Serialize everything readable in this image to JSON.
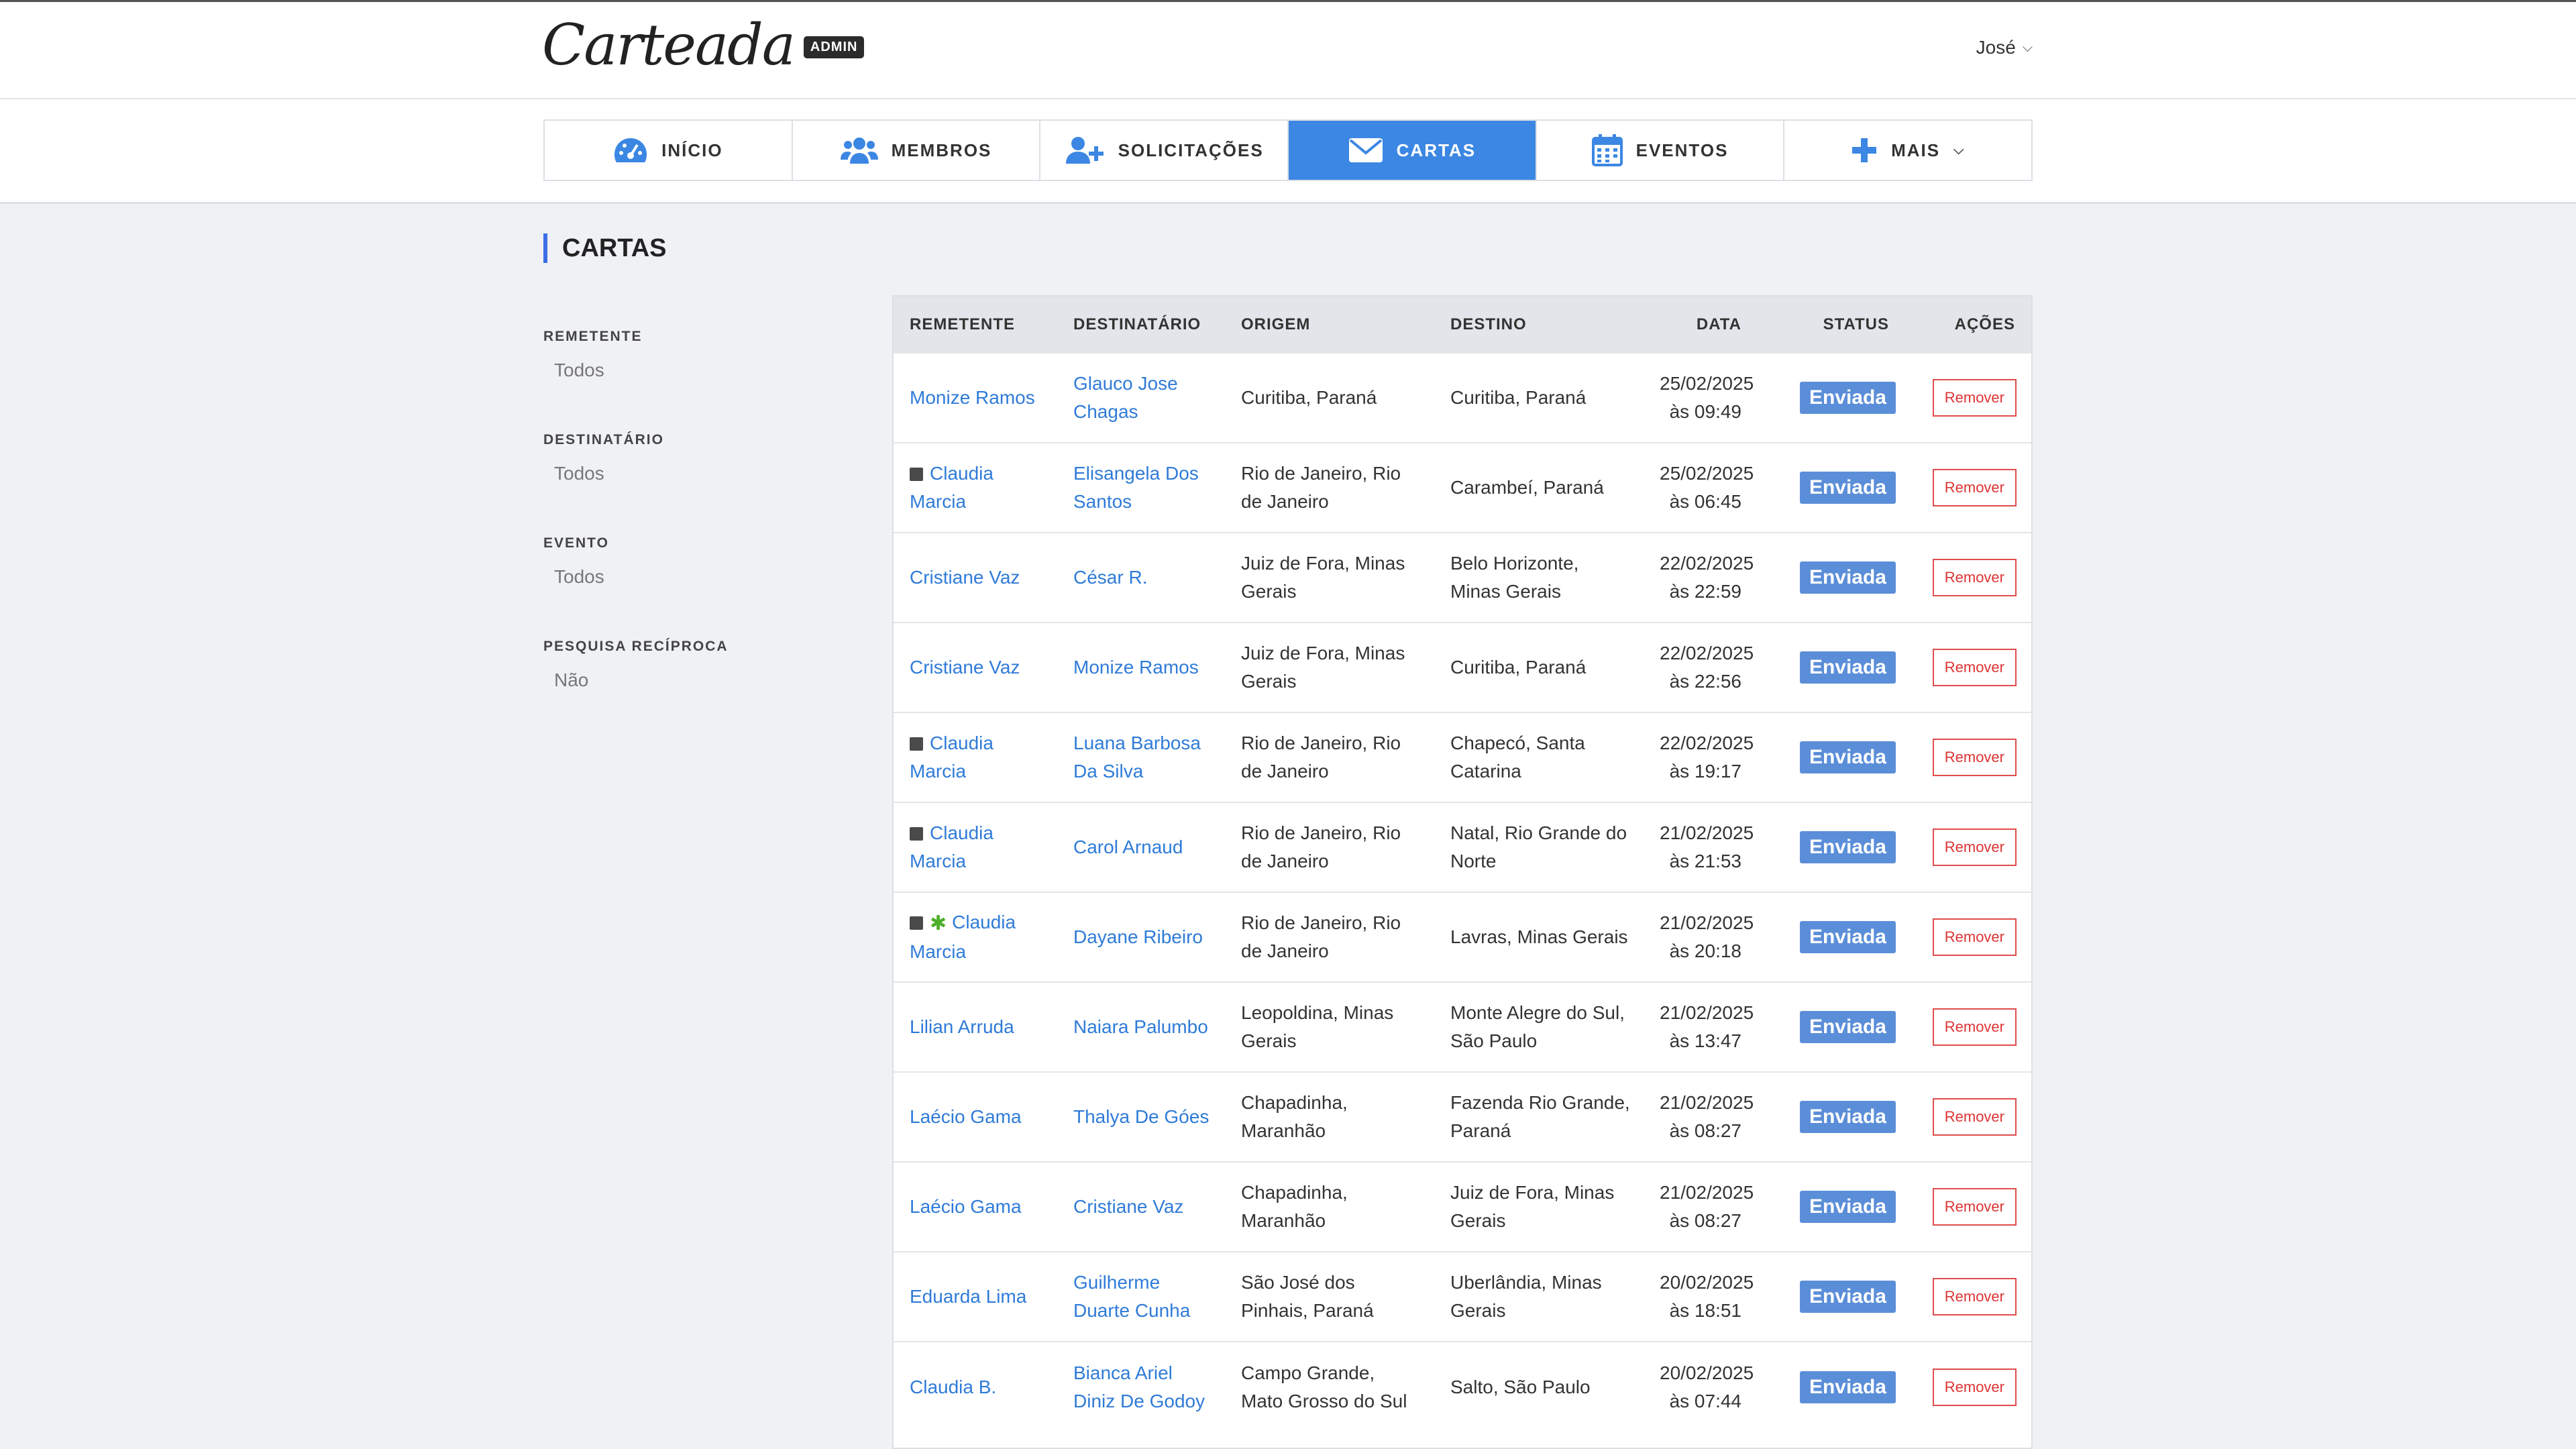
{
  "header": {
    "logo_text": "Carteada",
    "admin_badge": "ADMIN",
    "user_name": "José"
  },
  "nav": [
    {
      "label": "INÍCIO",
      "icon": "dashboard-icon",
      "active": false
    },
    {
      "label": "MEMBROS",
      "icon": "users-icon",
      "active": false
    },
    {
      "label": "SOLICITAÇÕES",
      "icon": "user-plus-icon",
      "active": false
    },
    {
      "label": "CARTAS",
      "icon": "envelope-icon",
      "active": true
    },
    {
      "label": "EVENTOS",
      "icon": "calendar-icon",
      "active": false
    },
    {
      "label": "MAIS",
      "icon": "plus-icon",
      "active": false
    }
  ],
  "page": {
    "title": "CARTAS"
  },
  "filters": [
    {
      "label": "REMETENTE",
      "value": "Todos"
    },
    {
      "label": "DESTINATÁRIO",
      "value": "Todos"
    },
    {
      "label": "EVENTO",
      "value": "Todos"
    },
    {
      "label": "PESQUISA RECÍPROCA",
      "value": "Não"
    }
  ],
  "table": {
    "columns": [
      "REMETENTE",
      "DESTINATÁRIO",
      "ORIGEM",
      "DESTINO",
      "DATA",
      "STATUS",
      "AÇÕES"
    ],
    "rows": [
      {
        "sender": "Monize Ramos",
        "recipient": "Glauco Jose Chagas",
        "origin": "Curitiba, Paraná",
        "destination": "Curitiba, Paraná",
        "date": "25/02/2025",
        "time": "às 09:49",
        "status": "Enviada",
        "action": "Remover",
        "note": false,
        "star": false
      },
      {
        "sender": "Claudia Marcia",
        "recipient": "Elisangela Dos Santos",
        "origin": "Rio de Janeiro, Rio de Janeiro",
        "destination": "Carambeí, Paraná",
        "date": "25/02/2025",
        "time": "às 06:45",
        "status": "Enviada",
        "action": "Remover",
        "note": true,
        "star": false
      },
      {
        "sender": "Cristiane Vaz",
        "recipient": "César R.",
        "origin": "Juiz de Fora, Minas Gerais",
        "destination": "Belo Horizonte, Minas Gerais",
        "date": "22/02/2025",
        "time": "às 22:59",
        "status": "Enviada",
        "action": "Remover",
        "note": false,
        "star": false
      },
      {
        "sender": "Cristiane Vaz",
        "recipient": "Monize Ramos",
        "origin": "Juiz de Fora, Minas Gerais",
        "destination": "Curitiba, Paraná",
        "date": "22/02/2025",
        "time": "às 22:56",
        "status": "Enviada",
        "action": "Remover",
        "note": false,
        "star": false
      },
      {
        "sender": "Claudia Marcia",
        "recipient": "Luana Barbosa Da Silva",
        "origin": "Rio de Janeiro, Rio de Janeiro",
        "destination": "Chapecó, Santa Catarina",
        "date": "22/02/2025",
        "time": "às 19:17",
        "status": "Enviada",
        "action": "Remover",
        "note": true,
        "star": false
      },
      {
        "sender": "Claudia Marcia",
        "recipient": "Carol Arnaud",
        "origin": "Rio de Janeiro, Rio de Janeiro",
        "destination": "Natal, Rio Grande do Norte",
        "date": "21/02/2025",
        "time": "às 21:53",
        "status": "Enviada",
        "action": "Remover",
        "note": true,
        "star": false
      },
      {
        "sender": "Claudia Marcia",
        "recipient": "Dayane Ribeiro",
        "origin": "Rio de Janeiro, Rio de Janeiro",
        "destination": "Lavras, Minas Gerais",
        "date": "21/02/2025",
        "time": "às 20:18",
        "status": "Enviada",
        "action": "Remover",
        "note": true,
        "star": true
      },
      {
        "sender": "Lilian Arruda",
        "recipient": "Naiara Palumbo",
        "origin": "Leopoldina, Minas Gerais",
        "destination": "Monte Alegre do Sul, São Paulo",
        "date": "21/02/2025",
        "time": "às 13:47",
        "status": "Enviada",
        "action": "Remover",
        "note": false,
        "star": false
      },
      {
        "sender": "Laécio Gama",
        "recipient": "Thalya De Góes",
        "origin": "Chapadinha, Maranhão",
        "destination": "Fazenda Rio Grande, Paraná",
        "date": "21/02/2025",
        "time": "às 08:27",
        "status": "Enviada",
        "action": "Remover",
        "note": false,
        "star": false
      },
      {
        "sender": "Laécio Gama",
        "recipient": "Cristiane Vaz",
        "origin": "Chapadinha, Maranhão",
        "destination": "Juiz de Fora, Minas Gerais",
        "date": "21/02/2025",
        "time": "às 08:27",
        "status": "Enviada",
        "action": "Remover",
        "note": false,
        "star": false
      },
      {
        "sender": "Eduarda Lima",
        "recipient": "Guilherme Duarte Cunha",
        "origin": "São José dos Pinhais, Paraná",
        "destination": "Uberlândia, Minas Gerais",
        "date": "20/02/2025",
        "time": "às 18:51",
        "status": "Enviada",
        "action": "Remover",
        "note": false,
        "star": false
      },
      {
        "sender": "Claudia B.",
        "recipient": "Bianca Ariel Diniz De Godoy",
        "origin": "Campo Grande, Mato Grosso do Sul",
        "destination": "Salto, São Paulo",
        "date": "20/02/2025",
        "time": "às 07:44",
        "status": "Enviada",
        "action": "Remover",
        "note": false,
        "star": false
      }
    ]
  },
  "colors": {
    "accent": "#3b87e3",
    "link": "#2f7bd8",
    "status_badge": "#5b8ed8",
    "remove_border": "#e14c4c",
    "title_bar": "#3b6fe3",
    "star": "#4caf29"
  }
}
